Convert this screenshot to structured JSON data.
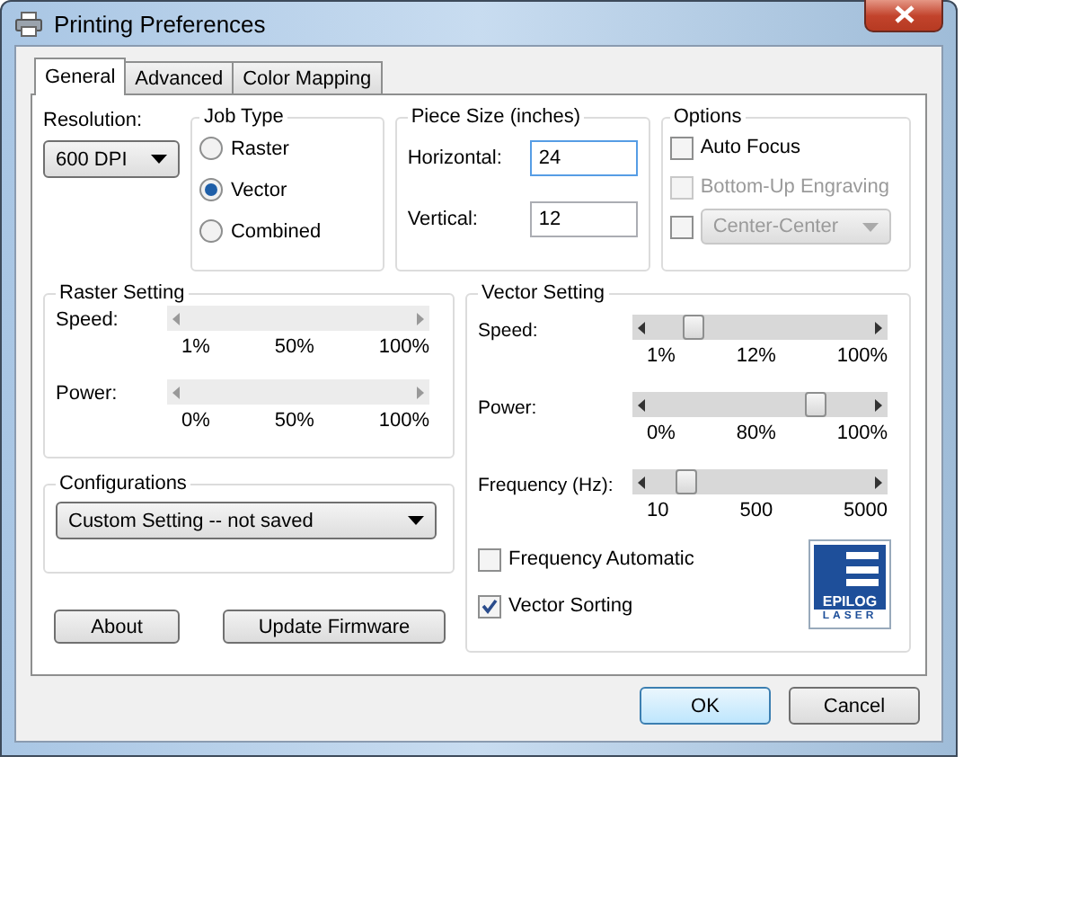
{
  "window": {
    "title": "Printing Preferences"
  },
  "tabs": [
    {
      "label": "General",
      "selected": true
    },
    {
      "label": "Advanced",
      "selected": false
    },
    {
      "label": "Color Mapping",
      "selected": false
    }
  ],
  "resolution": {
    "label": "Resolution:",
    "value": "600 DPI"
  },
  "job_type": {
    "title": "Job Type",
    "options": [
      {
        "label": "Raster",
        "selected": false
      },
      {
        "label": "Vector",
        "selected": true
      },
      {
        "label": "Combined",
        "selected": false
      }
    ]
  },
  "piece_size": {
    "title": "Piece Size (inches)",
    "fields": [
      {
        "label": "Horizontal:",
        "value": "24",
        "focused": true
      },
      {
        "label": "Vertical:",
        "value": "12",
        "focused": false
      }
    ]
  },
  "options": {
    "title": "Options",
    "items": [
      {
        "kind": "checkbox",
        "label": "Auto Focus",
        "checked": false,
        "disabled": false
      },
      {
        "kind": "checkbox",
        "label": "Bottom-Up Engraving",
        "checked": false,
        "disabled": true
      },
      {
        "kind": "checkbox-select",
        "value": "Center-Center",
        "checked": false,
        "disabled": true
      }
    ]
  },
  "raster": {
    "title": "Raster Setting",
    "sliders": [
      {
        "label": "Speed:",
        "disabled": true,
        "ticks": [
          "1%",
          "50%",
          "100%"
        ]
      },
      {
        "label": "Power:",
        "disabled": true,
        "ticks": [
          "0%",
          "50%",
          "100%"
        ]
      }
    ]
  },
  "configurations": {
    "title": "Configurations",
    "value": "Custom Setting -- not saved"
  },
  "side_buttons": [
    "About",
    "Update Firmware"
  ],
  "vector": {
    "title": "Vector Setting",
    "sliders": [
      {
        "label": "Speed:",
        "disabled": false,
        "level": 0.2,
        "ticks": [
          "1%",
          "12%",
          "100%"
        ]
      },
      {
        "label": "Power:",
        "disabled": false,
        "level": 0.75,
        "ticks": [
          "0%",
          "80%",
          "100%"
        ]
      },
      {
        "label": "Frequency (Hz):",
        "disabled": false,
        "level": 0.17,
        "ticks": [
          "10",
          "500",
          "5000"
        ]
      }
    ],
    "checkboxes": [
      {
        "label": "Frequency Automatic",
        "checked": false
      },
      {
        "label": "Vector Sorting",
        "checked": true
      }
    ]
  },
  "logo": {
    "lines": [
      "EPILOG",
      "LASER"
    ]
  },
  "buttons": [
    {
      "label": "OK",
      "default": true
    },
    {
      "label": "Cancel",
      "default": false
    }
  ]
}
